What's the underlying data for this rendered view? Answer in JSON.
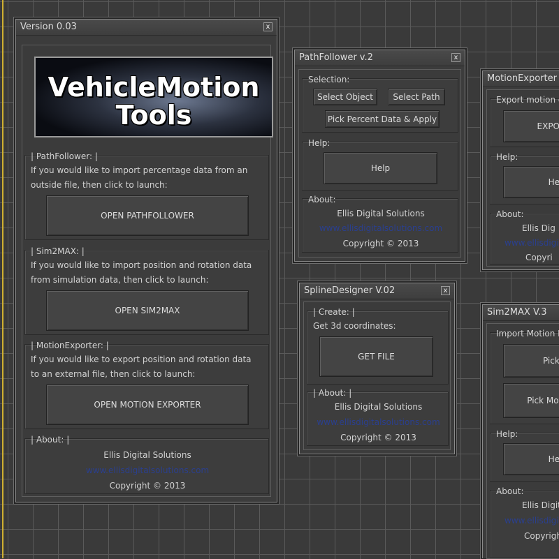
{
  "main_window": {
    "title": "Version 0.03",
    "close": "x",
    "banner_line1": "VehicleMotion",
    "banner_line2": "Tools",
    "pathfollower": {
      "label": "| PathFollower: |",
      "desc1": "If you would like to import percentage data from an",
      "desc2": "outside file, then click to launch:",
      "button": "OPEN PATHFOLLOWER"
    },
    "sim2max": {
      "label": "| Sim2MAX: |",
      "desc1": "If you would like to import position and rotation data",
      "desc2": "from simulation data, then click to launch:",
      "button": "OPEN SIM2MAX"
    },
    "motionexporter": {
      "label": "| MotionExporter: |",
      "desc1": "If you would like to export position and rotation data",
      "desc2": "to an external file, then click to launch:",
      "button": "OPEN MOTION EXPORTER"
    },
    "about": {
      "label": "| About: |",
      "company": "Ellis Digital Solutions",
      "url": "www.ellisdigitalsolutions.com",
      "copyright": "Copyright © 2013"
    }
  },
  "pathfollower_window": {
    "title": "PathFollower v.2",
    "close": "x",
    "selection_label": "Selection:",
    "select_object": "Select Object",
    "select_path": "Select Path",
    "pick_percent": "Pick Percent Data & Apply",
    "help_label": "Help:",
    "help_button": "Help",
    "about_label": "About:",
    "company": "Ellis Digital Solutions",
    "url": "www.ellisdigitalsolutions.com",
    "copyright": "Copyright © 2013"
  },
  "splinedesigner_window": {
    "title": "SplineDesigner V.02",
    "close": "x",
    "create_label": "| Create: |",
    "desc": "Get 3d coordinates:",
    "get_file": "GET FILE",
    "about_label": "| About: |",
    "company": "Ellis Digital Solutions",
    "url": "www.ellisdigitalsolutions.com",
    "copyright": "Copyright © 2013"
  },
  "motionexporter_window": {
    "title": "MotionExporter V",
    "export_label": "Export motion d",
    "export_button": "EXPO",
    "help_label": "Help:",
    "help_button": "He",
    "about_label": "About:",
    "company": "Ellis Dig",
    "url": "www.ellisdigita",
    "copyright": "Copyri"
  },
  "sim2max_window": {
    "title": "Sim2MAX V.3",
    "import_label": "Import Motion D",
    "pick_button": "Pick C",
    "pick_motion_button": "Pick Motio",
    "help_label": "Help:",
    "help_button": "He",
    "about_label": "About:",
    "company": "Ellis Digit",
    "url": "www.ellisdigita",
    "copyright": "Copyrigh"
  }
}
